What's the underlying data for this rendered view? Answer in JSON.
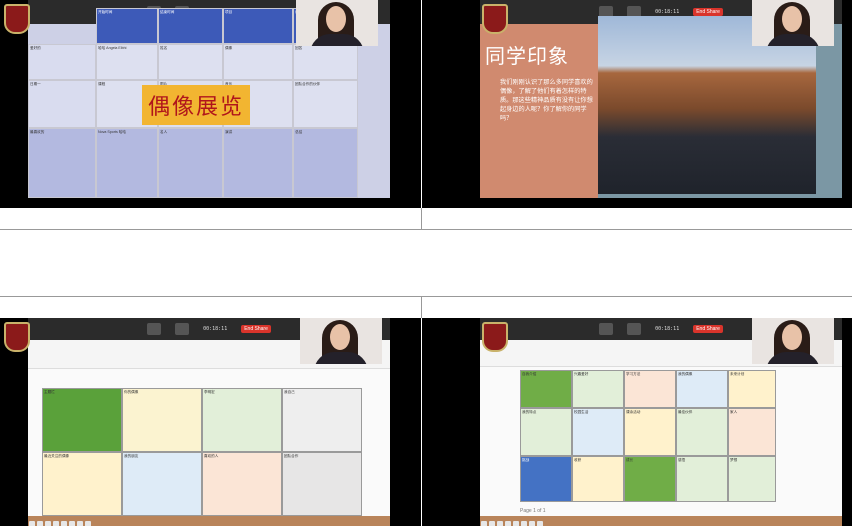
{
  "zoom": {
    "time_display": "00:18:11",
    "end_label": "End Share",
    "share_label": "Stop Share",
    "menu_app": "DingTalk"
  },
  "tile1": {
    "overlay_title": "偶像展览",
    "header_cells": [
      "开始时间",
      "结束时间",
      "项目",
      "说明",
      "备注"
    ],
    "rows": [
      [
        "爱好的",
        "哈哈 Angela Elbhi",
        "姓名",
        "偶像",
        "回答"
      ],
      [
        "日期一",
        "课程",
        "图片",
        "音乐",
        "团队合作的伙伴"
      ],
      [
        "最喜欢的",
        "Nova Sports 哈哈",
        "名人",
        "演讲",
        "总结"
      ]
    ]
  },
  "tile2": {
    "title": "同学印象",
    "body": "我们刚刚认识了那么多同学喜欢的偶像，了解了他们有着怎样的特质。那这些精神品质有没有让你想起身边的人呢？你了解你的同学吗？"
  },
  "tile3": {
    "menu": [
      "DingTalk",
      "Edit",
      "Window",
      "Help"
    ],
    "cells": [
      "主题栏",
      "你的偶像",
      "李明宏",
      "我自己",
      "最近关注的偶像",
      "我的朋友",
      "喜欢的人",
      "团队合作"
    ],
    "cell_colors": [
      "#5aa13a",
      "#fbf3d0",
      "#e2efd9",
      "#eeeeee",
      "#fff2cc",
      "#deebf7",
      "#fbe5d6",
      "#e7e6e6"
    ]
  },
  "tile4": {
    "menu": [
      "DingTalk",
      "Edit",
      "Window",
      "Help"
    ],
    "status": "Page 1 of 1",
    "cells": [
      "自我介绍",
      "兴趣爱好",
      "学习方法",
      "我的偶像",
      "未来计划",
      "我的特点",
      "校园生活",
      "课余活动",
      "最佳伙伴",
      "家人",
      "梦想",
      "心愿",
      "挑战",
      "收获",
      "成长",
      "感悟"
    ],
    "cell_colors": [
      "#70ad47",
      "#e2efd9",
      "#fbe5d6",
      "#deebf7",
      "#fff2cc",
      "#e2efd9",
      "#deebf7",
      "#fff2cc",
      "#70ad47",
      "#fbe5d6",
      "#e2efd9",
      "#fff2cc",
      "#4472c4",
      "#fff2cc",
      "#70ad47",
      "#e2efd9"
    ]
  }
}
